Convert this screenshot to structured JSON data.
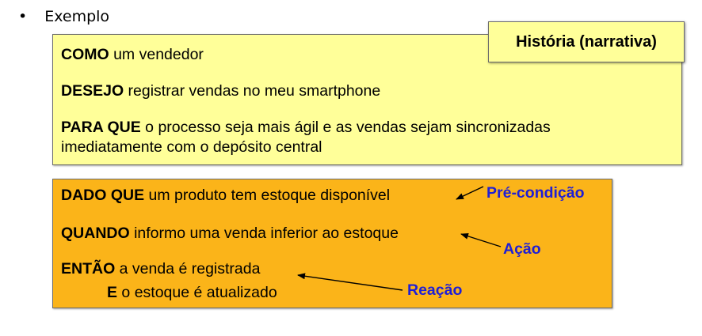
{
  "bullet": {
    "marker": "•",
    "text": "Exemplo"
  },
  "story": {
    "tag": "História (narrativa)",
    "lines": [
      {
        "keyword": "COMO",
        "text": " um vendedor"
      },
      {
        "keyword": "DESEJO",
        "text": " registrar vendas no meu smartphone"
      },
      {
        "keyword": "PARA QUE",
        "text": " o processo seja mais ágil e as vendas sejam sincronizadas"
      },
      {
        "keyword": "",
        "text": "imediatamente com o depósito central"
      }
    ]
  },
  "criteria": {
    "lines": [
      {
        "keyword": "DADO QUE",
        "text": " um produto tem estoque disponível"
      },
      {
        "keyword": "QUANDO",
        "text": " informo uma venda inferior ao estoque"
      },
      {
        "keyword": "ENTÃO",
        "text": " a venda é registrada"
      },
      {
        "keyword": "E",
        "text": " o estoque é atualizado"
      }
    ]
  },
  "callouts": {
    "precondition": "Pré-condição",
    "action": "Ação",
    "reaction": "Reação"
  },
  "colors": {
    "story_bg": "#ffff99",
    "criteria_bg": "#fbb419",
    "callout_text": "#1f1fd6"
  }
}
